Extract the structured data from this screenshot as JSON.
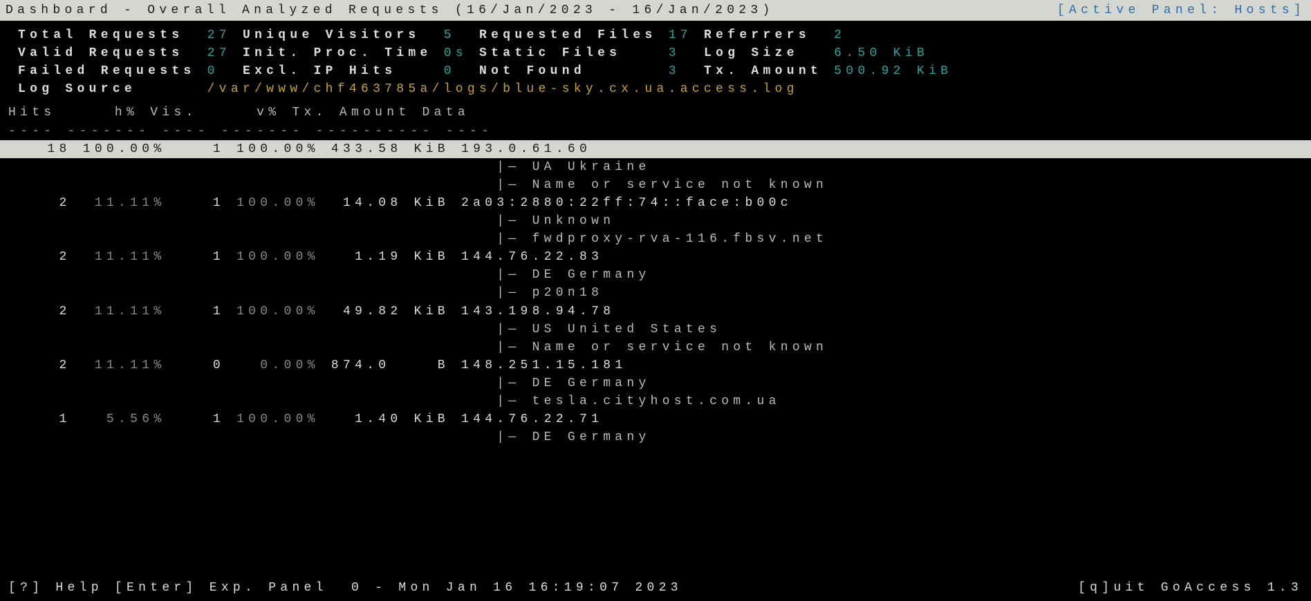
{
  "header": {
    "title": "Dashboard - Overall Analyzed Requests (16/Jan/2023 - 16/Jan/2023)",
    "active_panel": "[Active Panel: Hosts]"
  },
  "stats": {
    "total_requests_label": "Total Requests ",
    "total_requests": "27",
    "unique_visitors_label": "Unique Visitors ",
    "unique_visitors": "5 ",
    "requested_files_label": "Requested Files",
    "requested_files": "17",
    "referrers_label": "Referrers ",
    "referrers": "2",
    "valid_requests_label": "Valid Requests ",
    "valid_requests": "27",
    "init_proc_label": "Init. Proc. Time",
    "init_proc": "0s",
    "static_files_label": "Static Files   ",
    "static_files": "3 ",
    "log_size_label": "Log Size  ",
    "log_size": "6.50 KiB",
    "failed_requests_label": "Failed Requests",
    "failed_requests": "0 ",
    "excl_ip_label": "Excl. IP Hits   ",
    "excl_ip": "0 ",
    "not_found_label": "Not Found      ",
    "not_found": "3 ",
    "tx_amount_label": "Tx. Amount",
    "tx_amount": "500.92 KiB",
    "log_source_label": "Log Source     ",
    "log_source": "/var/www/chf463785a/logs/blue-sky.cx.ua.access.log"
  },
  "columns": {
    "hits": "Hits",
    "hpct": "h%",
    "vis": "Vis.",
    "vpct": "v%",
    "tx": "Tx. Amount",
    "data": "Data"
  },
  "divider": "---- ------- ---- ------- ---------- ----",
  "rows": [
    {
      "hits": "18",
      "hpct": "100.00%",
      "vis": "1",
      "vpct": "100.00%",
      "tx": "433.58 KiB",
      "data": "193.0.61.60",
      "selected": true
    },
    {
      "tree": "|— UA Ukraine"
    },
    {
      "tree": "|— Name or service not known"
    },
    {
      "hits": " 2",
      "hpct": " 11.11%",
      "vis": "1",
      "vpct": "100.00%",
      "tx": " 14.08 KiB",
      "data": "2a03:2880:22ff:74::face:b00c"
    },
    {
      "tree": "|— Unknown"
    },
    {
      "tree": "|— fwdproxy-rva-116.fbsv.net"
    },
    {
      "hits": " 2",
      "hpct": " 11.11%",
      "vis": "1",
      "vpct": "100.00%",
      "tx": "  1.19 KiB",
      "data": "144.76.22.83"
    },
    {
      "tree": "|— DE Germany"
    },
    {
      "tree": "|— p20n18"
    },
    {
      "hits": " 2",
      "hpct": " 11.11%",
      "vis": "1",
      "vpct": "100.00%",
      "tx": " 49.82 KiB",
      "data": "143.198.94.78"
    },
    {
      "tree": "|— US United States"
    },
    {
      "tree": "|— Name or service not known"
    },
    {
      "hits": " 2",
      "hpct": " 11.11%",
      "vis": "0",
      "vpct": "  0.00%",
      "tx": "874.0    B",
      "data": "148.251.15.181"
    },
    {
      "tree": "|— DE Germany"
    },
    {
      "tree": "|— tesla.cityhost.com.ua"
    },
    {
      "hits": " 1",
      "hpct": "  5.56%",
      "vis": "1",
      "vpct": "100.00%",
      "tx": "  1.40 KiB",
      "data": "144.76.22.71"
    },
    {
      "tree": "|— DE Germany"
    }
  ],
  "footer": {
    "left": "[?] Help [Enter] Exp. Panel  0 - Mon Jan 16 16:19:07 2023",
    "right": "[q]uit GoAccess 1.3"
  }
}
